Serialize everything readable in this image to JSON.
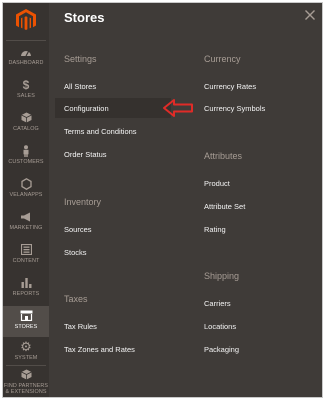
{
  "sidebar": {
    "items": [
      {
        "label": "DASHBOARD",
        "icon": "dashboard-icon"
      },
      {
        "label": "SALES",
        "icon": "dollar-icon"
      },
      {
        "label": "CATALOG",
        "icon": "cube-icon"
      },
      {
        "label": "CUSTOMERS",
        "icon": "person-icon"
      },
      {
        "label": "VELANAPPS",
        "icon": "hexagon-icon"
      },
      {
        "label": "MARKETING",
        "icon": "megaphone-icon"
      },
      {
        "label": "CONTENT",
        "icon": "content-icon"
      },
      {
        "label": "REPORTS",
        "icon": "bar-chart-icon"
      },
      {
        "label": "STORES",
        "icon": "store-icon"
      },
      {
        "label": "SYSTEM",
        "icon": "gear-icon"
      },
      {
        "label": "FIND PARTNERS\n& EXTENSIONS",
        "icon": "extensions-icon"
      }
    ],
    "active": "STORES"
  },
  "panel": {
    "title": "Stores",
    "settings": {
      "title": "Settings",
      "links": [
        "All Stores",
        "Configuration",
        "Terms and Conditions",
        "Order Status"
      ]
    },
    "inventory": {
      "title": "Inventory",
      "links": [
        "Sources",
        "Stocks"
      ]
    },
    "taxes": {
      "title": "Taxes",
      "links": [
        "Tax Rules",
        "Tax Zones and Rates"
      ]
    },
    "currency": {
      "title": "Currency",
      "links": [
        "Currency Rates",
        "Currency Symbols"
      ]
    },
    "attributes": {
      "title": "Attributes",
      "links": [
        "Product",
        "Attribute Set",
        "Rating"
      ]
    },
    "shipping": {
      "title": "Shipping",
      "links": [
        "Carriers",
        "Locations",
        "Packaging"
      ]
    }
  },
  "colors": {
    "sidebar_bg": "#373330",
    "panel_bg": "#3f3b38",
    "logo_orange": "#eb5202",
    "annotation_arrow": "#e02b27"
  }
}
